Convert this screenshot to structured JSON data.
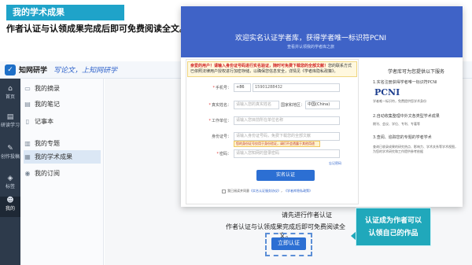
{
  "slide": {
    "title": "我的学术成果",
    "subtitle": "作者认证与认领成果完成后即可免费阅读全文。"
  },
  "app": {
    "brand": "知网研学",
    "slogan": "写论文，上知网研学",
    "logo_icon": "check-logo-icon"
  },
  "rail": {
    "items": [
      {
        "icon": "home-icon",
        "label": "首页",
        "glyph": "⌂"
      },
      {
        "icon": "study-icon",
        "label": "研读学习",
        "glyph": "▤"
      },
      {
        "icon": "write-icon",
        "label": "创作投稿",
        "glyph": "✎"
      },
      {
        "icon": "tag-icon",
        "label": "标签",
        "glyph": "◈"
      },
      {
        "icon": "user-icon",
        "label": "我的",
        "glyph": "☻"
      }
    ]
  },
  "sidebar": {
    "items": [
      {
        "label": "我的摘录",
        "icon": "excerpt-icon",
        "glyph": "▭"
      },
      {
        "label": "我的笔记",
        "icon": "note-icon",
        "glyph": "▤"
      },
      {
        "label": "记事本",
        "icon": "notepad-icon",
        "glyph": "▯"
      },
      {
        "label": "我的专题",
        "icon": "topic-icon",
        "glyph": "▥"
      },
      {
        "label": "我的学术成果",
        "icon": "achievement-icon",
        "glyph": "▦"
      },
      {
        "label": "我的订阅",
        "icon": "subscribe-icon",
        "glyph": "◉"
      }
    ],
    "active_index": 4
  },
  "modal": {
    "title": "欢迎实名认证学者库，获得学者唯一标识符PCNI",
    "subtitle": "查看并认领我的学者库之旅",
    "notice_prefix": "亲爱的用户！",
    "notice_highlight": "请输入身份证号码进行实名验证，随时可免费下载您的全部文献！",
    "notice_rest": "您的联系方式已依照法律用户授权进行加密存储，以确保您信息安全，详情见《学者库隐私政策》。",
    "fields": [
      {
        "label": "手机号：",
        "prefix": "+86",
        "value": "15901288432",
        "required": true
      },
      {
        "label": "真实姓名：",
        "value": "",
        "placeholder": "请输入您的真实姓名",
        "required": true,
        "extra_label": "国家和地区：",
        "extra_value": "中国(China)"
      },
      {
        "label": "工作单位：",
        "value": "",
        "placeholder": "请输入您目前所在单位名称",
        "required": true
      },
      {
        "label": "身份证号：",
        "value": "",
        "placeholder": "请输入身份证号码，免费下载您的全部文献",
        "required": false,
        "tip": "您的身份证号仅用于身份验证，请们不会透露于其他用途"
      },
      {
        "label": "密码：",
        "value": "",
        "placeholder": "请输入您知网的登录密码",
        "required": true
      }
    ],
    "forgot_link": "忘记密码",
    "verify_button": "实名认证",
    "agree_text": "我已阅读并同意",
    "agree_link1": "《实名认证服务协议》",
    "agree_and": "，",
    "agree_link2": "《学者库隐私政策》",
    "benefits_title": "学者库可为您提供以下服务",
    "benefit1": "1.实名注册获得学者唯一标识符PCNI",
    "pcni_logo": "PCNI",
    "benefit1_desc": "学者唯一标识符，免费提供您学术身份",
    "benefit2": "2.自动收集整理中外文各类型学术成果",
    "benefit2_desc": "期刊、会议、学位、专利、专著等",
    "benefit3": "3.查阅、追踪您的专题的学者学术",
    "benefit3_desc": "查询已收录成果的研究热点、影响力、学术关系等学术视图，为您的学术研究和工作提供参考依据"
  },
  "below": {
    "line1": "请先进行作者认证",
    "line2": "作者认证与认领成果完成后即可免费阅读全文。",
    "cta_button": "立即认证"
  },
  "callout": {
    "line1": "认证成为作者可以",
    "line2": "认领自己的作品"
  },
  "colors": {
    "accent": "#1fa3c9",
    "primary_button": "#2c6fd3",
    "modal_header": "#3f63c7",
    "callout": "#20a8bb",
    "rail": "#2d3a4b"
  }
}
